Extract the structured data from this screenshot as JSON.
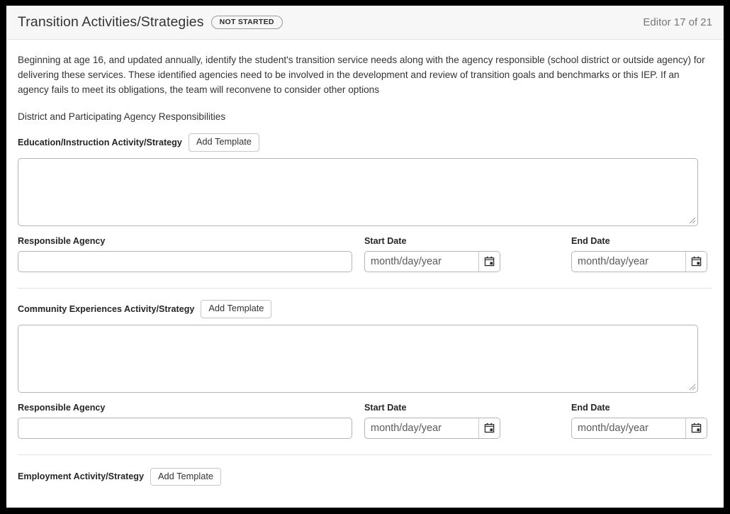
{
  "header": {
    "title": "Transition Activities/Strategies",
    "status_badge": "NOT STARTED",
    "editor_count": "Editor 17 of 21"
  },
  "body": {
    "intro_text": "Beginning at age 16, and updated annually, identify the student's transition service needs along with the agency responsible (school district or outside agency) for delivering these services. These identified agencies need to be involved in the development and review of transition goals and benchmarks or this IEP. If an agency fails to meet its obligations, the team will reconvene to consider other options",
    "subsection_title": "District and Participating Agency Responsibilities"
  },
  "labels": {
    "add_template": "Add Template",
    "responsible_agency": "Responsible Agency",
    "start_date": "Start Date",
    "end_date": "End Date",
    "date_placeholder": "month/day/year",
    "agency_value": "",
    "narrative_value": ""
  },
  "sections": [
    {
      "label": "Education/Instruction Activity/Strategy"
    },
    {
      "label": "Community Experiences Activity/Strategy"
    },
    {
      "label": "Employment Activity/Strategy"
    }
  ],
  "icons": {
    "calendar": "calendar-icon",
    "resize": "resize-grip-icon"
  },
  "colors": {
    "header_bg": "#f7f7f7",
    "text": "#333333",
    "muted": "#767676",
    "border": "#b5b5b5",
    "frame": "#000000"
  }
}
